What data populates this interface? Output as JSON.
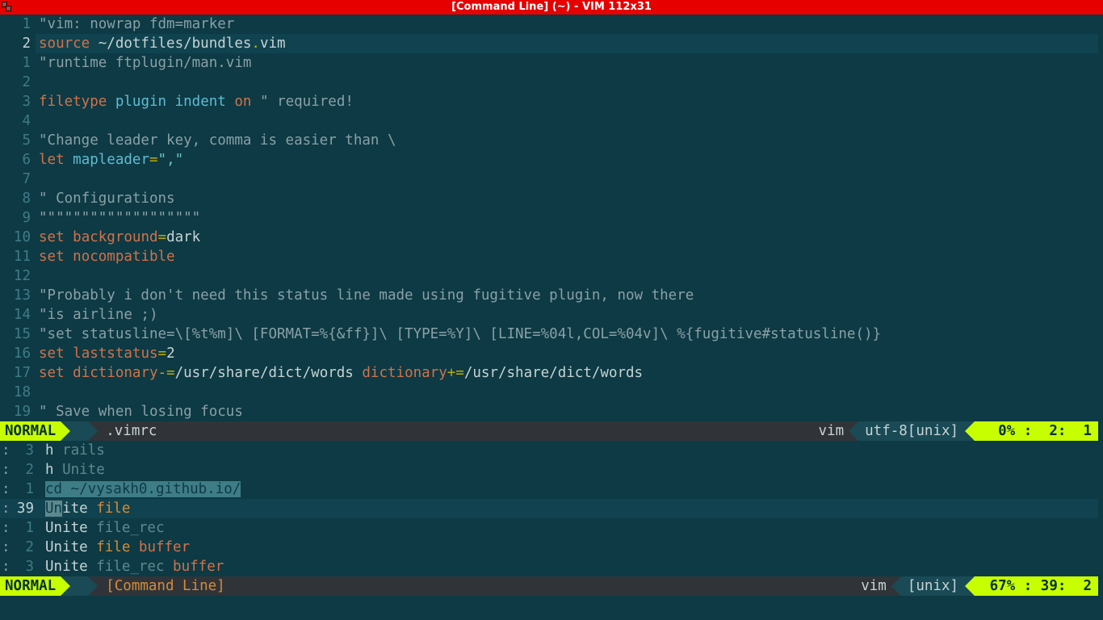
{
  "window": {
    "title": "[Command Line] (~) - VIM 112x31"
  },
  "editor": {
    "file_label": ".vimrc",
    "lines": [
      {
        "rel": "1",
        "tokens": [
          {
            "t": "\"vim: nowrap fdm=marker",
            "c": "c-comment"
          }
        ]
      },
      {
        "rel": "2",
        "cur": true,
        "tokens": [
          {
            "t": "source",
            "c": "c-keyword"
          },
          {
            "t": " ~/dotfiles/bundles",
            "c": "c-plain"
          },
          {
            "t": ".",
            "c": "c-delim"
          },
          {
            "t": "vim",
            "c": "c-plain"
          }
        ]
      },
      {
        "rel": "1",
        "tokens": [
          {
            "t": "\"runtime ftplugin/man.vim",
            "c": "c-comment"
          }
        ]
      },
      {
        "rel": "2",
        "tokens": []
      },
      {
        "rel": "3",
        "tokens": [
          {
            "t": "filetype",
            "c": "c-keyword"
          },
          {
            "t": " ",
            "c": "c-plain"
          },
          {
            "t": "plugin",
            "c": "c-func"
          },
          {
            "t": " ",
            "c": "c-plain"
          },
          {
            "t": "indent",
            "c": "c-func"
          },
          {
            "t": " ",
            "c": "c-plain"
          },
          {
            "t": "on",
            "c": "c-option"
          },
          {
            "t": " ",
            "c": "c-plain"
          },
          {
            "t": "\" required!",
            "c": "c-comment"
          }
        ]
      },
      {
        "rel": "4",
        "tokens": []
      },
      {
        "rel": "5",
        "tokens": [
          {
            "t": "\"Change leader key, comma is easier than \\",
            "c": "c-comment"
          }
        ]
      },
      {
        "rel": "6",
        "tokens": [
          {
            "t": "let",
            "c": "c-keyword"
          },
          {
            "t": " ",
            "c": "c-plain"
          },
          {
            "t": "mapleader",
            "c": "c-func"
          },
          {
            "t": "=",
            "c": "c-delim"
          },
          {
            "t": "\",\"",
            "c": "c-string"
          }
        ]
      },
      {
        "rel": "7",
        "tokens": []
      },
      {
        "rel": "8",
        "tokens": [
          {
            "t": "\" Configurations",
            "c": "c-comment"
          }
        ]
      },
      {
        "rel": "9",
        "tokens": [
          {
            "t": "\"\"\"\"\"\"\"\"\"\"\"\"\"\"\"\"\"\"\"",
            "c": "c-comment"
          }
        ]
      },
      {
        "rel": "10",
        "tokens": [
          {
            "t": "set",
            "c": "c-keyword"
          },
          {
            "t": " ",
            "c": "c-plain"
          },
          {
            "t": "background",
            "c": "c-option"
          },
          {
            "t": "=",
            "c": "c-delim"
          },
          {
            "t": "dark",
            "c": "c-plain"
          }
        ]
      },
      {
        "rel": "11",
        "tokens": [
          {
            "t": "set",
            "c": "c-keyword"
          },
          {
            "t": " ",
            "c": "c-plain"
          },
          {
            "t": "nocompatible",
            "c": "c-option"
          }
        ]
      },
      {
        "rel": "12",
        "tokens": []
      },
      {
        "rel": "13",
        "tokens": [
          {
            "t": "\"Probably i don't need this status line made using fugitive plugin, now there",
            "c": "c-comment"
          }
        ]
      },
      {
        "rel": "14",
        "tokens": [
          {
            "t": "\"is airline ;)",
            "c": "c-comment"
          }
        ]
      },
      {
        "rel": "15",
        "tokens": [
          {
            "t": "\"set statusline=\\[%t%m]\\ [FORMAT=%{&ff}]\\ [TYPE=%Y]\\ [LINE=%04l,COL=%04v]\\ %{fugitive#statusline()}",
            "c": "c-comment"
          }
        ]
      },
      {
        "rel": "16",
        "tokens": [
          {
            "t": "set",
            "c": "c-keyword"
          },
          {
            "t": " ",
            "c": "c-plain"
          },
          {
            "t": "laststatus",
            "c": "c-option"
          },
          {
            "t": "=",
            "c": "c-delim"
          },
          {
            "t": "2",
            "c": "c-plain"
          }
        ]
      },
      {
        "rel": "17",
        "tokens": [
          {
            "t": "set",
            "c": "c-keyword"
          },
          {
            "t": " ",
            "c": "c-plain"
          },
          {
            "t": "dictionary",
            "c": "c-option"
          },
          {
            "t": "-=",
            "c": "c-delim"
          },
          {
            "t": "/usr/share/dict/words ",
            "c": "c-plain"
          },
          {
            "t": "dictionary",
            "c": "c-option"
          },
          {
            "t": "+=",
            "c": "c-delim"
          },
          {
            "t": "/usr/share/dict/words",
            "c": "c-plain"
          }
        ]
      },
      {
        "rel": "18",
        "tokens": []
      },
      {
        "rel": "19",
        "tokens": [
          {
            "t": "\" Save when losing focus",
            "c": "c-comment"
          }
        ]
      }
    ]
  },
  "status_top": {
    "mode": "NORMAL",
    "file": ".vimrc",
    "filetype": "vim",
    "encoding": "utf-8[unix]",
    "position": "  0% :  2:  1"
  },
  "command_window": {
    "rows": [
      {
        "colon": ":",
        "num": "3",
        "body_raw": [
          {
            "t": "h ",
            "c": "cmd-name"
          },
          {
            "t": "rails",
            "c": "c-muted"
          }
        ]
      },
      {
        "colon": ":",
        "num": "2",
        "body_raw": [
          {
            "t": "h ",
            "c": "cmd-name"
          },
          {
            "t": "Unite",
            "c": "c-muted"
          }
        ]
      },
      {
        "colon": ":",
        "num": "1",
        "body_raw": [
          {
            "t": "cd ~/vysakh0.github.io/",
            "c": "sel"
          }
        ]
      },
      {
        "colon": ":",
        "num": "39",
        "big": true,
        "cur": true,
        "body_raw": [
          {
            "t": "Un",
            "c": "cursor-u"
          },
          {
            "t": "ite ",
            "c": "cmd-name"
          },
          {
            "t": "file",
            "c": "cmd-arg1"
          }
        ]
      },
      {
        "colon": ":",
        "num": "1",
        "body_raw": [
          {
            "t": "Unite ",
            "c": "cmd-name"
          },
          {
            "t": "file_rec",
            "c": "c-muted"
          }
        ]
      },
      {
        "colon": ":",
        "num": "2",
        "body_raw": [
          {
            "t": "Unite ",
            "c": "cmd-name"
          },
          {
            "t": "file ",
            "c": "cmd-arg1"
          },
          {
            "t": "buffer",
            "c": "cmd-arg2"
          }
        ]
      },
      {
        "colon": ":",
        "num": "3",
        "body_raw": [
          {
            "t": "Unite ",
            "c": "cmd-name"
          },
          {
            "t": "file_rec ",
            "c": "c-muted"
          },
          {
            "t": "buffer",
            "c": "cmd-arg2"
          }
        ]
      }
    ]
  },
  "status_bottom": {
    "mode": "NORMAL",
    "file": "[Command Line]",
    "filetype": "vim",
    "encoding": "[unix]",
    "position": " 67% : 39:  2"
  }
}
